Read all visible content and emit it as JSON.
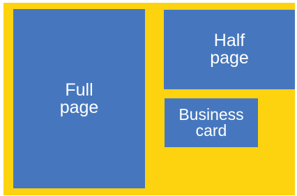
{
  "colors": {
    "background": "#FDD20F",
    "block": "#4677BE",
    "text": "#ffffff"
  },
  "blocks": {
    "full": {
      "line1": "Full",
      "line2": "page"
    },
    "half": {
      "line1": "Half",
      "line2": "page"
    },
    "business": {
      "line1": "Business",
      "line2": "card"
    }
  }
}
